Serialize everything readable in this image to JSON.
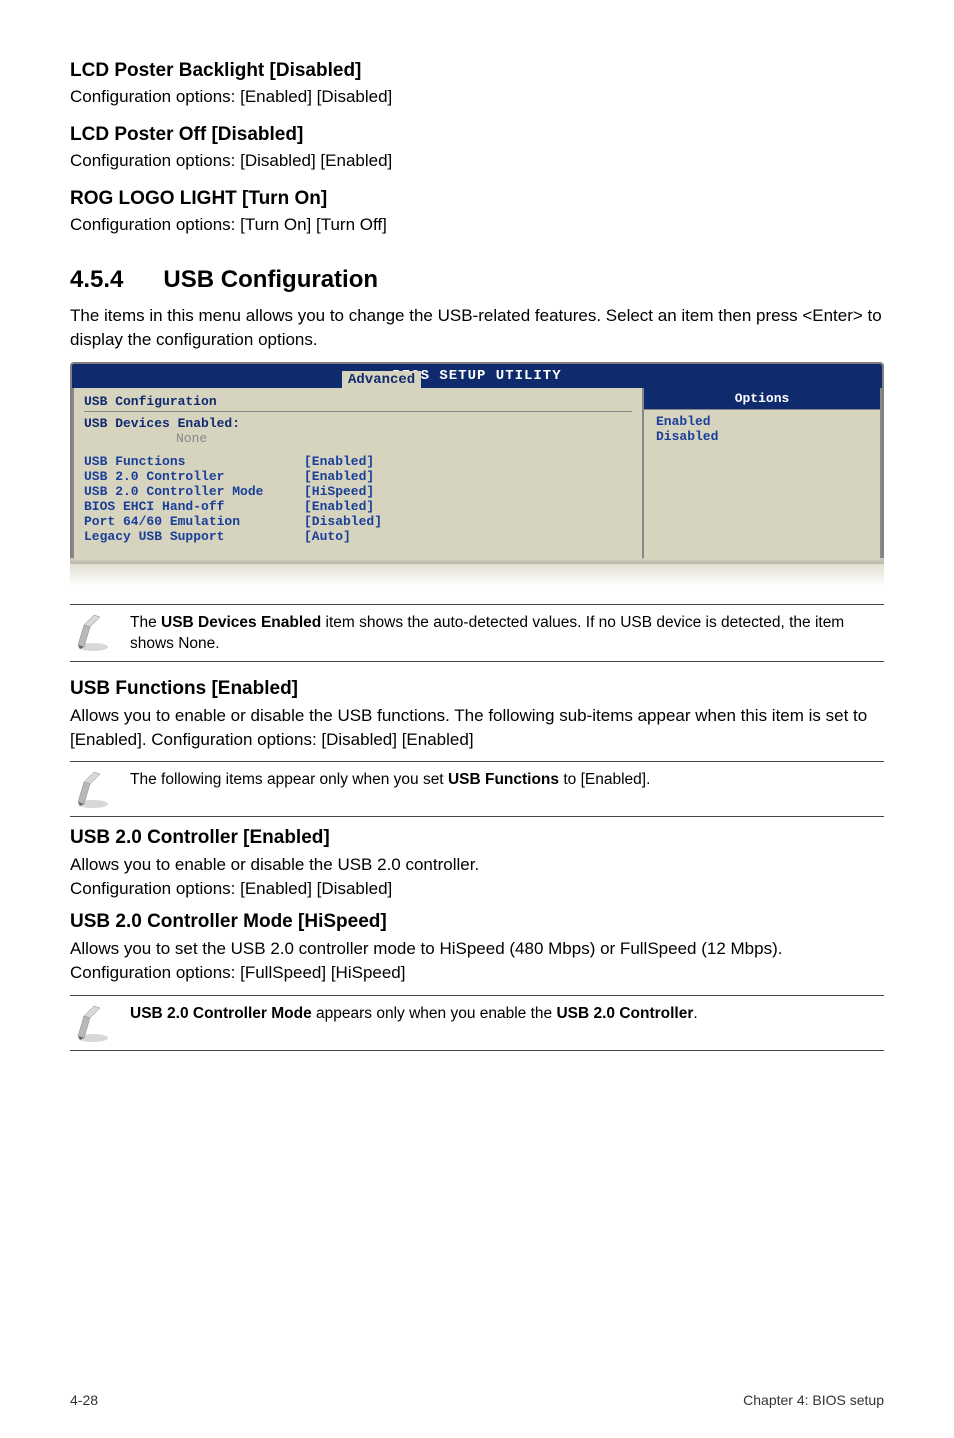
{
  "sections": {
    "lcd_backlight": {
      "title": "LCD Poster Backlight [Disabled]",
      "body": "Configuration options: [Enabled] [Disabled]"
    },
    "lcd_poster_off": {
      "title": "LCD Poster Off [Disabled]",
      "body": "Configuration options: [Disabled] [Enabled]"
    },
    "rog_logo": {
      "title": "ROG LOGO LIGHT [Turn On]",
      "body": "Configuration options: [Turn On] [Turn Off]"
    }
  },
  "major": {
    "number": "4.5.4",
    "title": "USB Configuration",
    "body": "The items in this menu allows you to change the USB-related features. Select an item then press <Enter> to display the configuration options."
  },
  "bios": {
    "utility_title": "BIOS SETUP UTILITY",
    "tab": "Advanced",
    "config_header": "USB Configuration",
    "devices_label": "USB Devices Enabled:",
    "devices_value": "None",
    "rows": [
      {
        "label": "USB Functions",
        "value": "[Enabled]"
      },
      {
        "label": "USB 2.0 Controller",
        "value": "[Enabled]"
      },
      {
        "label": "USB 2.0 Controller Mode",
        "value": "[HiSpeed]"
      },
      {
        "label": "BIOS EHCI Hand-off",
        "value": "[Enabled]"
      },
      {
        "label": "Port 64/60 Emulation",
        "value": "[Disabled]"
      },
      {
        "label": "Legacy USB Support",
        "value": "[Auto]"
      }
    ],
    "options_header": "Options",
    "options": [
      "Enabled",
      "Disabled"
    ]
  },
  "note1": {
    "prefix": "The ",
    "bold": "USB Devices Enabled",
    "suffix": " item shows the auto-detected values. If no USB device is detected, the item shows None."
  },
  "usb_functions": {
    "title": "USB Functions [Enabled]",
    "body": "Allows you to enable or disable the USB functions. The following sub-items appear when this item is set to [Enabled]. Configuration options: [Disabled] [Enabled]"
  },
  "note2": {
    "prefix": "The following items appear only when you set ",
    "bold": "USB Functions",
    "suffix": " to [Enabled]."
  },
  "usb20_controller": {
    "title": "USB 2.0 Controller [Enabled]",
    "body": "Allows you to enable or disable the USB 2.0 controller.\nConfiguration options: [Enabled] [Disabled]"
  },
  "usb20_mode": {
    "title": "USB 2.0 Controller Mode [HiSpeed]",
    "body": "Allows you to set the USB 2.0 controller mode to HiSpeed (480 Mbps) or FullSpeed (12 Mbps). Configuration options: [FullSpeed] [HiSpeed]"
  },
  "note3": {
    "bold1": "USB 2.0 Controller Mode",
    "mid": " appears only when you enable the ",
    "bold2": "USB 2.0 Controller",
    "suffix": "."
  },
  "footer": {
    "left": "4-28",
    "right": "Chapter 4: BIOS setup"
  }
}
